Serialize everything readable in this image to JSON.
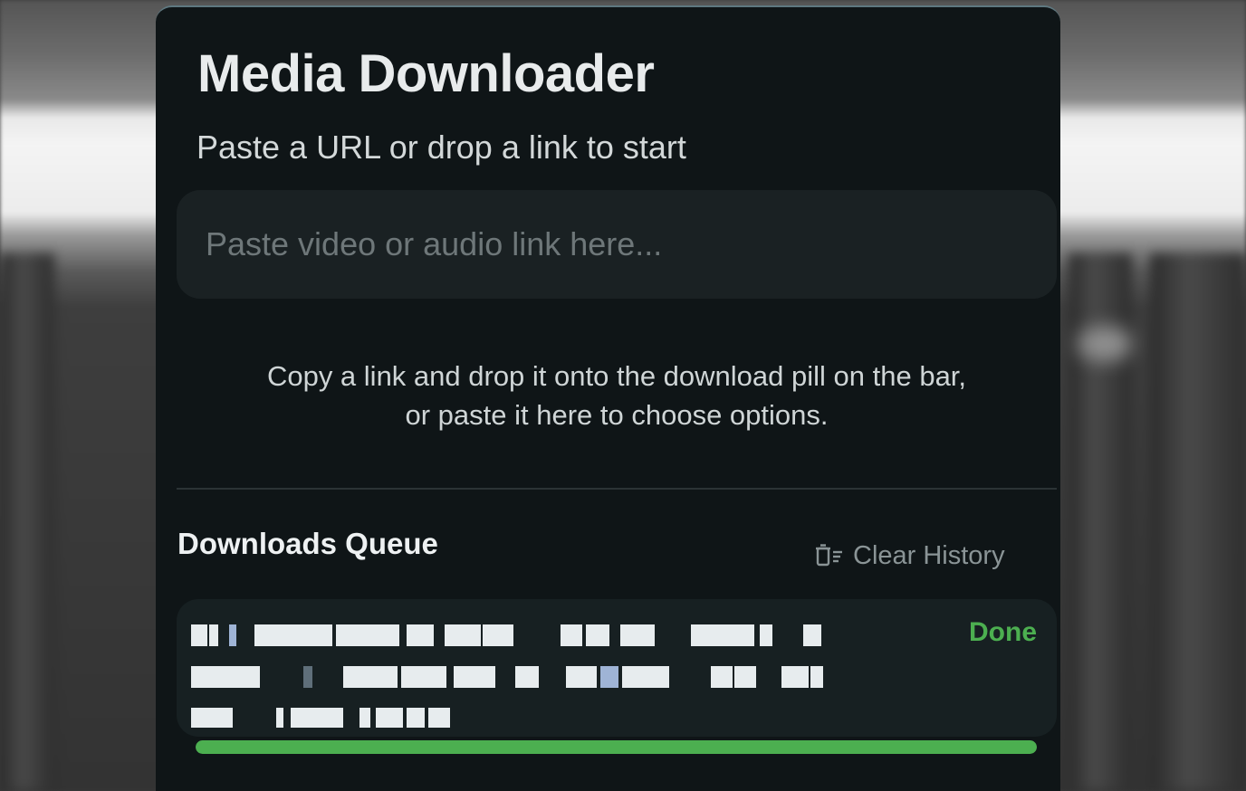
{
  "app": {
    "title": "Media Downloader",
    "subtitle": "Paste a URL or drop a link to start"
  },
  "url_input": {
    "value": "",
    "placeholder": "Paste video or audio link here..."
  },
  "hint": {
    "line1": "Copy a link and drop it onto the download pill on the bar,",
    "line2": "or paste it here to choose options."
  },
  "queue": {
    "title": "Downloads Queue",
    "clear_label": "Clear History",
    "clear_icon": "clear-history-icon",
    "items": [
      {
        "name": "",
        "status": "Done",
        "progress": 1.0
      }
    ]
  },
  "colors": {
    "accent": "#4caf50",
    "panel": "#0f1517",
    "input": "#1a2123"
  }
}
